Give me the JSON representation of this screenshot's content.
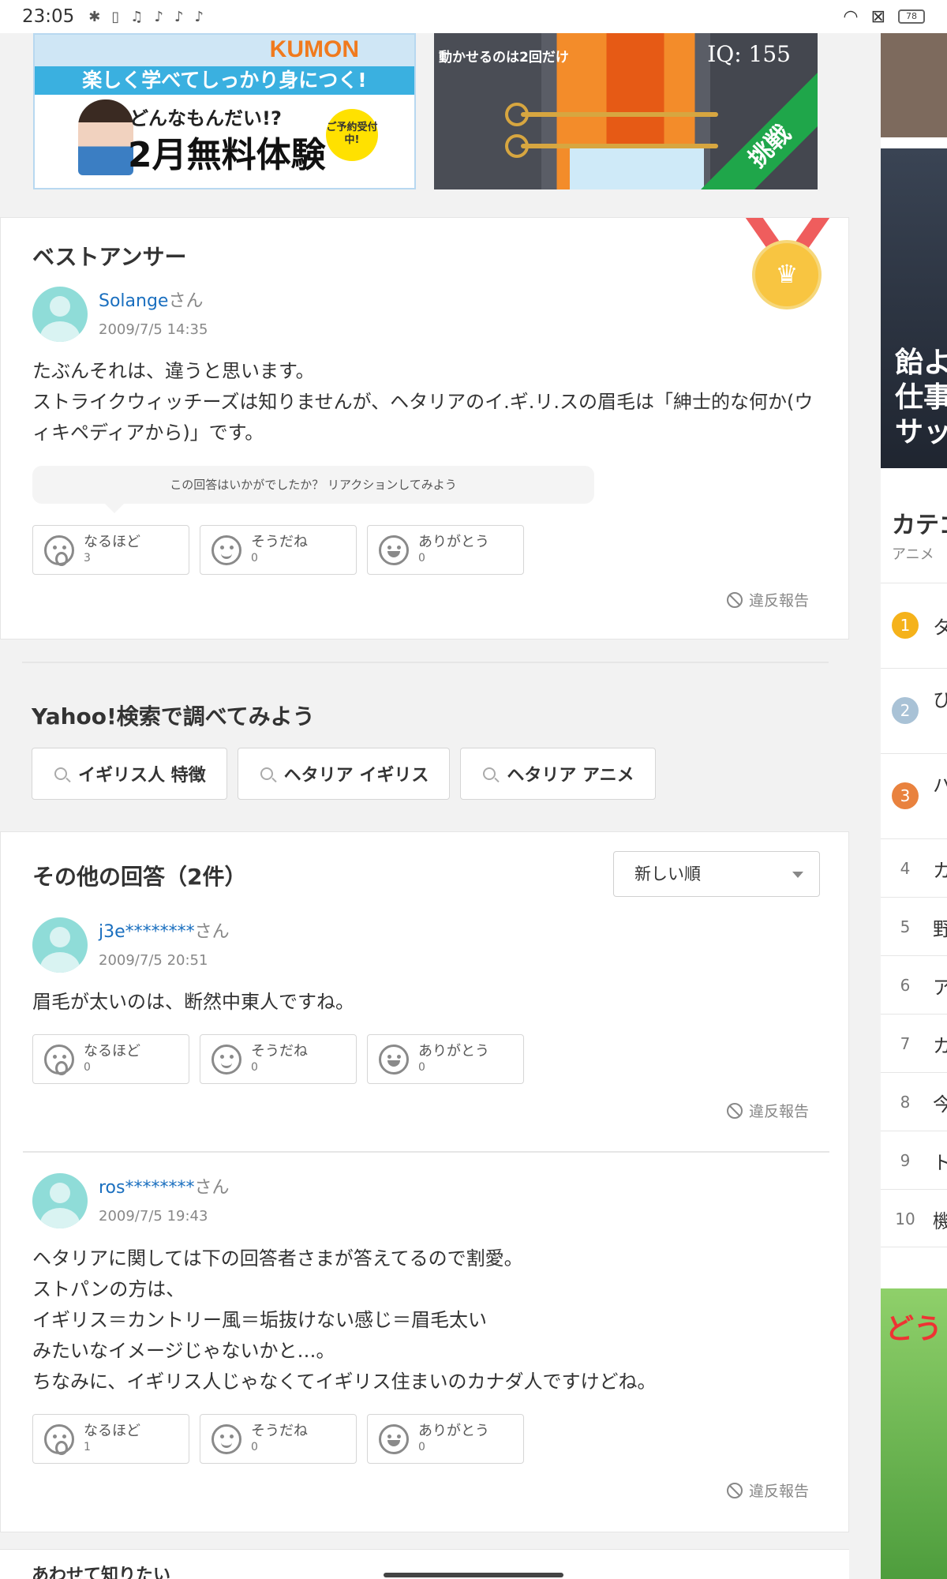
{
  "status_bar": {
    "time": "23:05",
    "battery": "78"
  },
  "ads": {
    "kumon": {
      "brand": "KUMON",
      "band": "楽しく学べてしっかり身につく!",
      "sub": "どんなもんだい!?",
      "headline": "2月無料体験",
      "seal": "ご予約受付中!"
    },
    "game": {
      "label": "動かせるのは2回だけ",
      "iq": "IQ: 155",
      "ribbon": "挑戦"
    }
  },
  "best_answer": {
    "heading": "ベストアンサー",
    "user": "Solange",
    "honorific": "さん",
    "date": "2009/7/5 14:35",
    "text": "たぶんそれは、違うと思います。\nストライクウィッチーズは知りませんが、ヘタリアのイ.ギ.リ.スの眉毛は「紳士的な何か(ウィキペディアから)」です。",
    "reaction_prompt": "この回答はいかがでしたか？ リアクションしてみよう",
    "reactions": [
      {
        "label": "なるほど",
        "count": "3"
      },
      {
        "label": "そうだね",
        "count": "0"
      },
      {
        "label": "ありがとう",
        "count": "0"
      }
    ],
    "report": "違反報告"
  },
  "search": {
    "title": "Yahoo!検索で調べてみよう",
    "chips": [
      "イギリス人 特徴",
      "ヘタリア イギリス",
      "ヘタリア アニメ"
    ]
  },
  "other_answers": {
    "heading": "その他の回答（2件）",
    "sort": "新しい順",
    "answers": [
      {
        "user": "j3e********",
        "honorific": "さん",
        "date": "2009/7/5 20:51",
        "text": "眉毛が太いのは、断然中東人ですね。",
        "reactions": [
          {
            "label": "なるほど",
            "count": "0"
          },
          {
            "label": "そうだね",
            "count": "0"
          },
          {
            "label": "ありがとう",
            "count": "0"
          }
        ],
        "report": "違反報告"
      },
      {
        "user": "ros********",
        "honorific": "さん",
        "date": "2009/7/5 19:43",
        "text": "ヘタリアに関しては下の回答者さまが答えてるので割愛。\nストパンの方は、\nイギリス＝カントリー風＝垢抜けない感じ＝眉毛太い\nみたいなイメージじゃないかと…。\nちなみに、イギリス人じゃなくてイギリス住まいのカナダ人ですけどね。",
        "reactions": [
          {
            "label": "なるほど",
            "count": "1"
          },
          {
            "label": "そうだね",
            "count": "0"
          },
          {
            "label": "ありがとう",
            "count": "0"
          }
        ],
        "report": "違反報告"
      }
    ]
  },
  "more_section": {
    "title": "あわせて知りたい"
  },
  "sidebar": {
    "banner_text": "飴よ\n仕事\nサッ",
    "category_title": "カテゴ",
    "category_sub": "アニメ",
    "ranking": [
      {
        "rank": "1",
        "text": "タ"
      },
      {
        "rank": "2",
        "text": "ひ"
      },
      {
        "rank": "3",
        "text": "ハ"
      },
      {
        "rank": "4",
        "text": "カ"
      },
      {
        "rank": "5",
        "text": "野"
      },
      {
        "rank": "6",
        "text": "ア"
      },
      {
        "rank": "7",
        "text": "カ"
      },
      {
        "rank": "8",
        "text": "今"
      },
      {
        "rank": "9",
        "text": "ト"
      },
      {
        "rank": "10",
        "text": "機"
      }
    ],
    "ad_text": "どう"
  },
  "colors": {
    "link": "#1a6fbf",
    "medal": "#f8c541",
    "rank_gold": "#f5b21a",
    "rank_silver": "#a9c2d6",
    "rank_bronze": "#e9823e"
  }
}
